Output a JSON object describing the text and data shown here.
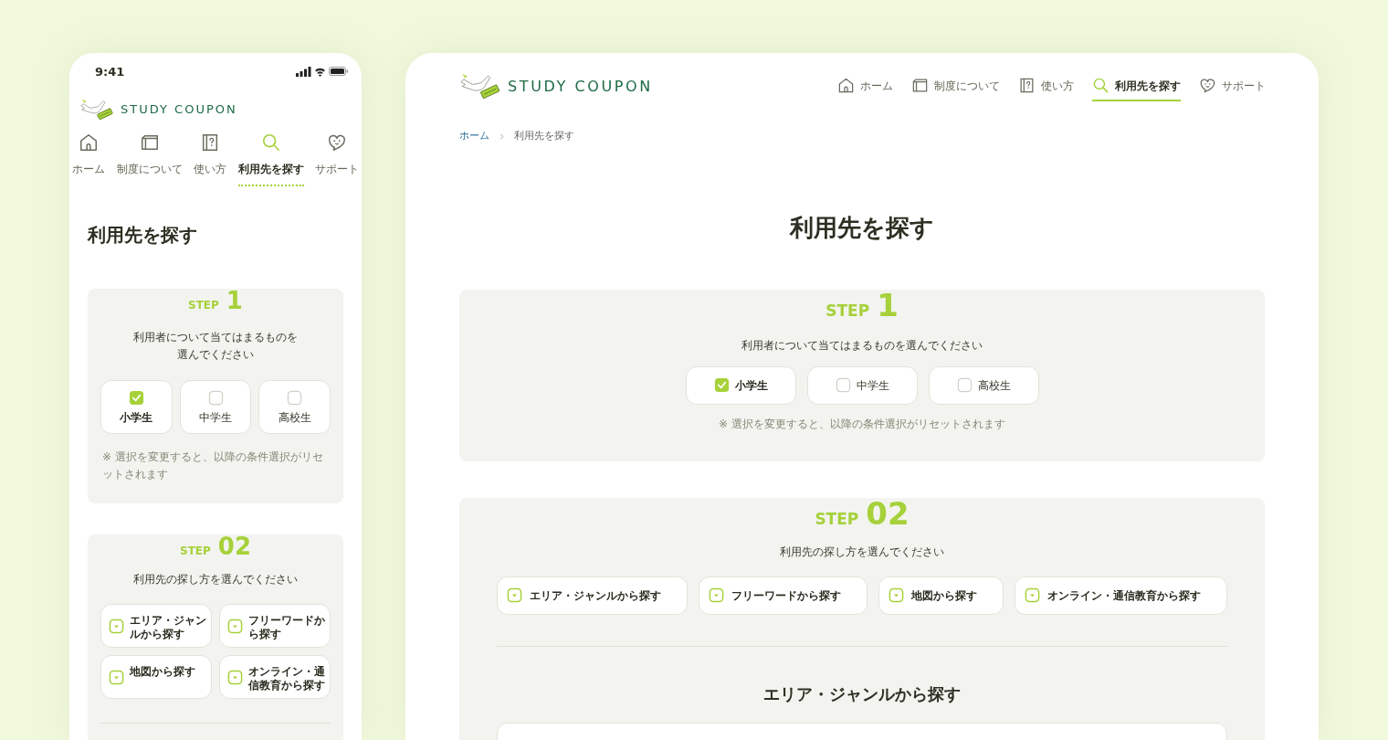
{
  "mobile": {
    "status_time": "9:41",
    "logo": "STUDY COUPON",
    "nav": [
      {
        "label": "ホーム",
        "selected": false
      },
      {
        "label": "制度について",
        "selected": false
      },
      {
        "label": "使い方",
        "selected": false
      },
      {
        "label": "利用先を探す",
        "selected": true
      },
      {
        "label": "サポート",
        "selected": false
      }
    ],
    "title": "利用先を探す",
    "step1": {
      "step": "STEP",
      "number": "1",
      "prompt": "利用者について当てはまるものを選んでください",
      "options": [
        {
          "label": "小学生",
          "checked": true
        },
        {
          "label": "中学生",
          "checked": false
        },
        {
          "label": "高校生",
          "checked": false
        }
      ],
      "note": "※ 選択を変更すると、以降の条件選択がリセットされます"
    },
    "step2": {
      "step": "STEP",
      "number": "02",
      "prompt": "利用先の探し方を選んでください",
      "methods": [
        "エリア・ジャンルから探す",
        "フリーワードから探す",
        "地図から探す",
        "オンライン・通信教育から探す"
      ]
    }
  },
  "desktop": {
    "logo": "STUDY COUPON",
    "nav": [
      {
        "label": "ホーム",
        "selected": false
      },
      {
        "label": "制度について",
        "selected": false
      },
      {
        "label": "使い方",
        "selected": false
      },
      {
        "label": "利用先を探す",
        "selected": true
      },
      {
        "label": "サポート",
        "selected": false
      }
    ],
    "breadcrumb": [
      "ホーム",
      "利用先を探す"
    ],
    "title": "利用先を探す",
    "step1": {
      "step": "STEP",
      "number": "1",
      "prompt": "利用者について当てはまるものを選んでください",
      "options": [
        {
          "label": "小学生",
          "checked": true
        },
        {
          "label": "中学生",
          "checked": false
        },
        {
          "label": "高校生",
          "checked": false
        }
      ],
      "note": "※ 選択を変更すると、以降の条件選択がリセットされます"
    },
    "step2": {
      "step": "STEP",
      "number": "02",
      "prompt": "利用先の探し方を選んでください",
      "methods": [
        "エリア・ジャンルから探す",
        "フリーワードから探す",
        "地図から探す",
        "オンライン・通信教育から探す"
      ],
      "section_title": "エリア・ジャンルから探す"
    }
  }
}
